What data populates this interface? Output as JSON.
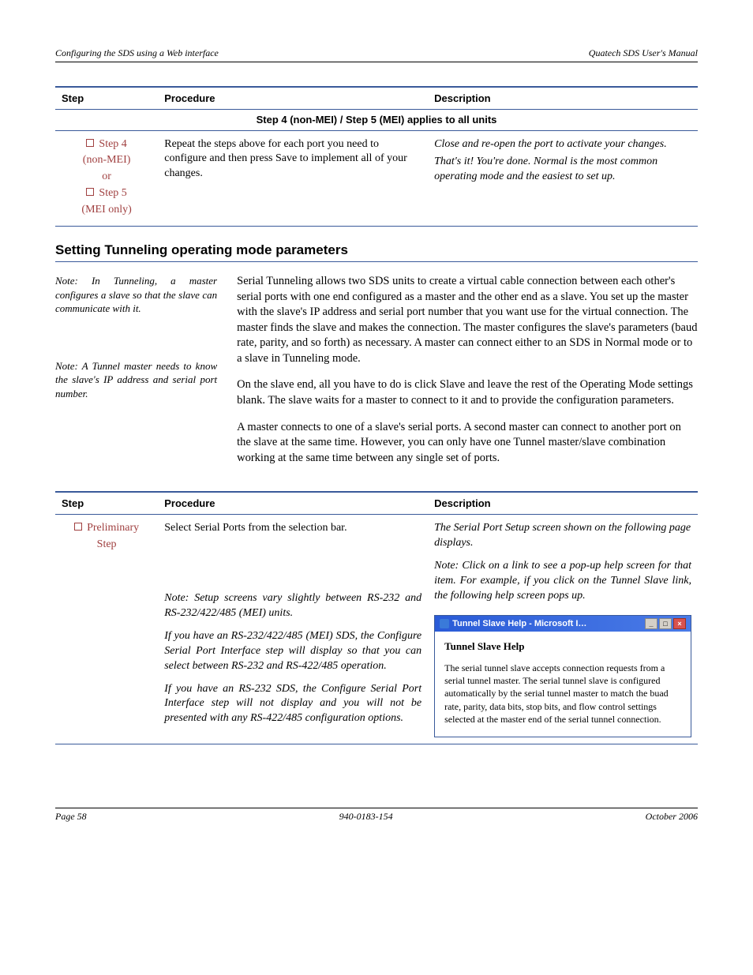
{
  "header": {
    "left": "Configuring the SDS using a Web interface",
    "right": "Quatech SDS User's Manual"
  },
  "table1": {
    "head": {
      "c1": "Step",
      "c2": "Procedure",
      "c3": "Description"
    },
    "spanrow": "Step 4 (non-MEI) / Step 5 (MEI) applies to all units",
    "row": {
      "step_a": "Step 4",
      "step_a_sub": "(non-MEI)",
      "or": "or",
      "step_b": "Step 5",
      "step_b_sub": "(MEI only)",
      "procedure": "Repeat the steps above for each port you need to configure and then press Save to implement all of your changes.",
      "desc1": "Close and re-open the port to activate your changes.",
      "desc2": "That's it! You're done. Normal is the most common operating mode and the easiest to set up."
    }
  },
  "section_heading": "Setting Tunneling operating mode parameters",
  "notes": {
    "n1": "Note: In Tunneling, a master configures a slave so that the slave can communicate with it.",
    "n2": "Note: A Tunnel master needs to know the slave's IP address and serial port number."
  },
  "body": {
    "p1": "Serial Tunneling allows two SDS units to create a virtual cable connection between each other's serial ports with one end configured as a master and the other end as a slave. You set up the master with the slave's IP address and serial port number that you want use for the virtual connection. The master finds the slave and makes the connection. The master configures the slave's parameters (baud rate, parity, and so forth) as necessary. A master can connect either to an SDS in Normal mode or to a slave in Tunneling mode.",
    "p2": "On the slave end, all you have to do is click Slave and leave the rest of the Operating Mode settings blank. The slave waits for a master to connect to it and to provide the configuration parameters.",
    "p3": "A master connects to one of a slave's serial ports. A second master can connect to another port on the slave at the same time. However, you can only have one Tunnel master/slave combination working at the same time between any single set of ports."
  },
  "table2": {
    "head": {
      "c1": "Step",
      "c2": "Procedure",
      "c3": "Description"
    },
    "row": {
      "step": "Preliminary",
      "step_sub": "Step",
      "procedure": "Select Serial Ports from the selection bar.",
      "proc_note1": "Note: Setup screens vary slightly between RS-232 and RS-232/422/485 (MEI) units.",
      "proc_note2": "If you have an RS-232/422/485 (MEI) SDS, the Configure Serial Port Interface step will display so that you can select between RS-232 and RS-422/485 operation.",
      "proc_note3": "If you have an RS-232 SDS, the Configure Serial Port Interface step will not display and you will not be presented with any RS-422/485 configuration options.",
      "desc1": "The Serial Port Setup screen shown on the following page displays.",
      "desc_note": "Note: Click on a link to see a pop-up help screen for that item. For example, if you click on the Tunnel Slave link, the following help screen pops up."
    },
    "help": {
      "title": "Tunnel Slave Help - Microsoft I…",
      "heading": "Tunnel Slave Help",
      "text": "The serial tunnel slave accepts connection requests from a serial tunnel master.  The serial tunnel slave is configured automatically by the serial tunnel master to match the buad rate, parity, data bits, stop bits, and flow control settings selected at the master end of the serial tunnel connection."
    }
  },
  "footer": {
    "left": "Page 58",
    "center": "940-0183-154",
    "right": "October 2006"
  }
}
